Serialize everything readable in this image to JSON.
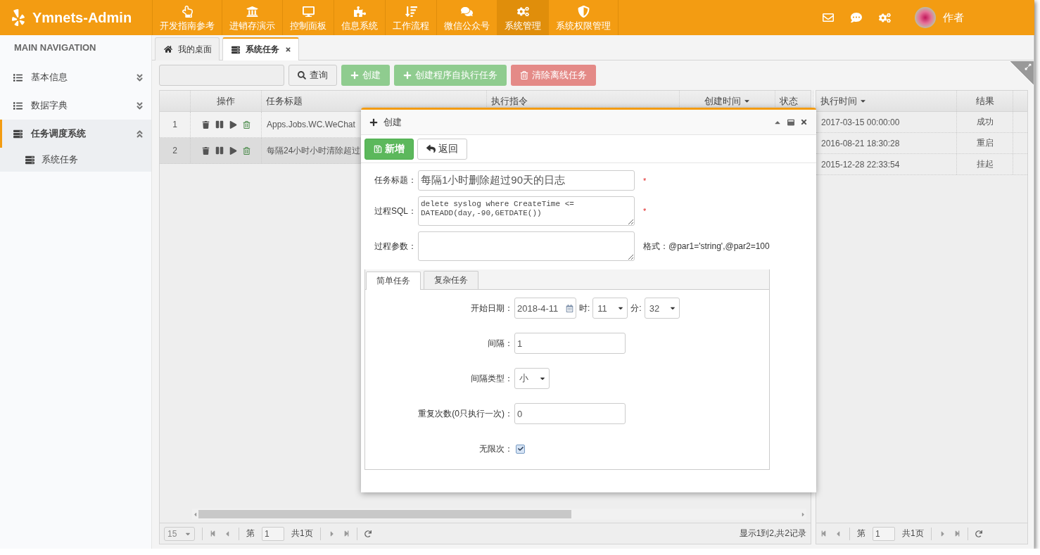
{
  "header": {
    "brand": "Ymnets-Admin",
    "nav": [
      {
        "label": "开发指南参考",
        "selected": false
      },
      {
        "label": "进销存演示",
        "selected": false
      },
      {
        "label": "控制面板",
        "selected": false
      },
      {
        "label": "信息系统",
        "selected": false
      },
      {
        "label": "工作流程",
        "selected": false
      },
      {
        "label": "微信公众号",
        "selected": false
      },
      {
        "label": "系统管理",
        "selected": true
      },
      {
        "label": "系统权限管理",
        "selected": false
      }
    ],
    "user": "作者"
  },
  "sidebar": {
    "heading": "MAIN NAVIGATION",
    "items": [
      {
        "label": "基本信息",
        "expanded": false,
        "selected": false
      },
      {
        "label": "数据字典",
        "expanded": false,
        "selected": false
      },
      {
        "label": "任务调度系统",
        "expanded": true,
        "selected": true,
        "children": [
          {
            "label": "系统任务"
          }
        ]
      }
    ]
  },
  "tabs": [
    {
      "label": "我的桌面",
      "selected": false,
      "closable": false
    },
    {
      "label": "系统任务",
      "selected": true,
      "closable": true
    }
  ],
  "toolbar": {
    "buttons": [
      {
        "label": "查询",
        "kind": "search"
      },
      {
        "label": "创建",
        "kind": "add"
      },
      {
        "label": "创建程序自执行任务",
        "kind": "add"
      },
      {
        "label": "清除离线任务",
        "kind": "delete"
      }
    ]
  },
  "task_grid": {
    "columns": [
      {
        "label": "操作",
        "sorted": false
      },
      {
        "label": "任务标题",
        "sorted": false
      },
      {
        "label": "执行指令",
        "sorted": false
      },
      {
        "label": "创建时间",
        "sorted": true
      },
      {
        "label": "状态",
        "sorted": false
      }
    ],
    "rows": [
      {
        "number": "1",
        "title": "Apps.Jobs.WC.WeChat",
        "selected": false
      },
      {
        "number": "2",
        "title": "每隔24小时小时清除超过",
        "selected": true
      }
    ],
    "pager": {
      "page_size": "15",
      "page_label": "第",
      "page": "1",
      "total_pages": "共1页",
      "summary": "显示1到2,共2记录"
    }
  },
  "log_grid": {
    "columns": [
      {
        "label": "执行时间",
        "sorted": true
      },
      {
        "label": "结果",
        "sorted": false
      }
    ],
    "rows": [
      {
        "time": "2017-03-15 00:00:00",
        "result": "成功"
      },
      {
        "time": "2016-08-21 18:30:28",
        "result": "重启"
      },
      {
        "time": "2015-12-28 22:33:54",
        "result": "挂起"
      }
    ],
    "pager": {
      "page_label": "第",
      "page": "1",
      "total_pages": "共1页"
    }
  },
  "dialog": {
    "title": "创建",
    "buttons": [
      {
        "label": "新增",
        "kind": "save"
      },
      {
        "label": "返回",
        "kind": "back"
      }
    ],
    "fields": [
      {
        "label": "任务标题：",
        "kind": "input",
        "value": "每隔1小时删除超过90天的日志",
        "mark": "*"
      },
      {
        "label": "过程SQL：",
        "kind": "textarea",
        "value": "delete syslog where CreateTime <= DATEADD(day,-90,GETDATE())",
        "mark": "*"
      },
      {
        "label": "过程参数：",
        "kind": "textarea",
        "note": "格式：@par1='string',@par2=100"
      }
    ],
    "tabs": [
      {
        "label": "简单任务",
        "selected": true
      },
      {
        "label": "复杂任务",
        "selected": false
      }
    ],
    "schedule": [
      {
        "kind": "datetime",
        "label": "开始日期：",
        "date": "2018-4-11",
        "hour_label": "时:",
        "hour": "11",
        "minute_label": "分:",
        "minute": "32"
      },
      {
        "kind": "input",
        "label": "间隔：",
        "value": "1"
      },
      {
        "kind": "select",
        "label": "间隔类型：",
        "value": "小"
      },
      {
        "kind": "input",
        "label": "重复次数(0只执行一次)：",
        "value": "0"
      },
      {
        "kind": "checkbox",
        "label": "无限次：",
        "checked": true
      }
    ]
  }
}
